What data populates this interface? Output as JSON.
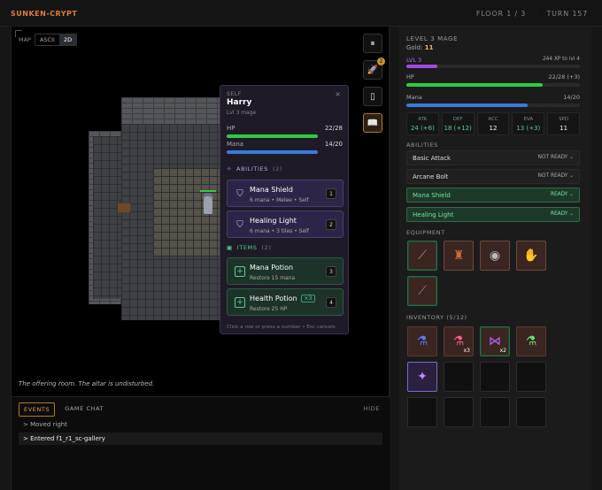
{
  "header": {
    "brand": "SUNKEN-CRYPT",
    "floor": "FLOOR 1 / 3",
    "turn": "TURN 157"
  },
  "map": {
    "label": "MAP",
    "modes": [
      "ASCII",
      "2D"
    ],
    "active_mode": "2D",
    "caption": "The offering room. The altar is undisturbed."
  },
  "side_buttons": [
    {
      "name": "pause",
      "icon": "pause-icon",
      "glyph": "⏸"
    },
    {
      "name": "rocket",
      "icon": "rocket-icon",
      "glyph": "🚀",
      "badge": "2"
    },
    {
      "name": "door",
      "icon": "door-icon",
      "glyph": "▯"
    },
    {
      "name": "book",
      "icon": "book-icon",
      "glyph": "📖"
    }
  ],
  "events": {
    "tabs": [
      "EVENTS",
      "GAME CHAT"
    ],
    "hide": "HIDE",
    "lines": [
      "> Moved right",
      "> Entered f1_r1_sc-gallery"
    ]
  },
  "popup": {
    "label": "SELF",
    "close": "×",
    "name": "Harry",
    "sub": "Lvl 3 mage",
    "hp_label": "HP",
    "hp_value": "22/28",
    "hp_fraction": 0.786,
    "mana_label": "Mana",
    "mana_value": "14/20",
    "mana_fraction": 0.7,
    "abilities_label": "ABILITIES",
    "abilities_count": "(2)",
    "abilities": [
      {
        "name": "Mana Shield",
        "desc": "6 mana • Melee • Self",
        "key": "1"
      },
      {
        "name": "Healing Light",
        "desc": "6 mana • 3 tiles • Self",
        "key": "2"
      }
    ],
    "items_label": "ITEMS",
    "items_count": "(2)",
    "items": [
      {
        "name": "Mana Potion",
        "desc": "Restore 15 mana",
        "key": "3",
        "tag": ""
      },
      {
        "name": "Health Potion",
        "desc": "Restore 25 HP",
        "key": "4",
        "tag": "×3"
      }
    ],
    "footer": "Click a row or press a number • Esc cancels"
  },
  "panel": {
    "title": "LEVEL 3 MAGE",
    "gold_label": "Gold:",
    "gold": "11",
    "lvl_label": "LVL 3",
    "xp_text": "244 XP to lvl 4",
    "xp_fraction": 0.18,
    "hp_label": "HP",
    "hp_value": "22/28 (+3)",
    "hp_fraction": 0.786,
    "mana_label": "Mana",
    "mana_value": "14/20",
    "mana_fraction": 0.7,
    "stats": [
      {
        "label": "ATK",
        "value": "24 (+6)",
        "boosted": true
      },
      {
        "label": "DEF",
        "value": "18 (+12)",
        "boosted": true
      },
      {
        "label": "ACC",
        "value": "12",
        "boosted": false
      },
      {
        "label": "EVA",
        "value": "13 (+3)",
        "boosted": true
      },
      {
        "label": "SPD",
        "value": "11",
        "boosted": false
      }
    ],
    "abilities_label": "ABILITIES",
    "abilities": [
      {
        "name": "Basic Attack",
        "status": "NOT READY ⌄",
        "ready": false
      },
      {
        "name": "Arcane Bolt",
        "status": "NOT READY ⌄",
        "ready": false
      },
      {
        "name": "Mana Shield",
        "status": "READY ⌄",
        "ready": true
      },
      {
        "name": "Healing Light",
        "status": "READY ⌄",
        "ready": true
      }
    ],
    "equipment_label": "EQUIPMENT",
    "equipment": [
      {
        "icon": "staff-icon",
        "glyph": "⟋"
      },
      {
        "icon": "armor-icon",
        "glyph": "♜"
      },
      {
        "icon": "ring-icon",
        "glyph": "◉"
      },
      {
        "icon": "gloves-icon",
        "glyph": "✋"
      },
      {
        "icon": "wand-icon",
        "glyph": "⟋"
      }
    ],
    "inventory_label": "INVENTORY (5/12)",
    "inventory": [
      {
        "icon": "blue-potion-icon",
        "glyph": "⚗",
        "qty": ""
      },
      {
        "icon": "red-potion-icon",
        "glyph": "⚗",
        "qty": "x3"
      },
      {
        "icon": "bow-tie-icon",
        "glyph": "⋈",
        "qty": "x2"
      },
      {
        "icon": "green-potion-icon",
        "glyph": "⚗",
        "qty": ""
      },
      {
        "icon": "crystal-icon",
        "glyph": "✦",
        "qty": ""
      }
    ]
  },
  "colors": {
    "accent": "#e07c3a",
    "hp": "#2ecc40",
    "mana": "#3a7ae0",
    "xp": "#a04ae0",
    "ready": "#7ce0a0"
  }
}
